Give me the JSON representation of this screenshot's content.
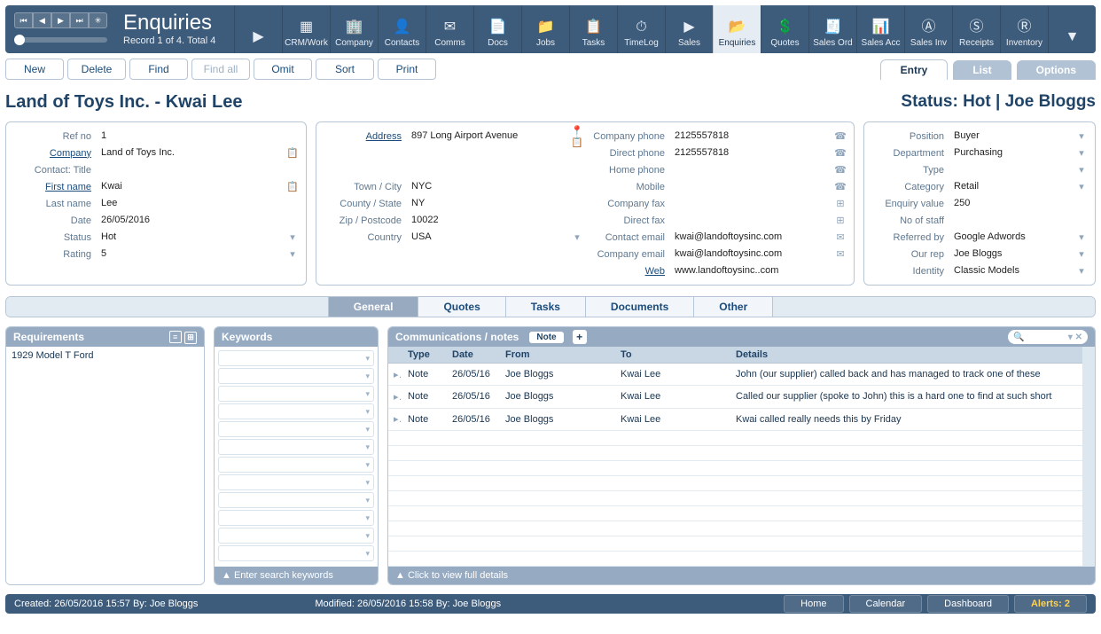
{
  "header": {
    "title": "Enquiries",
    "record_status": "Record 1 of 4. Total 4",
    "nav_buttons": [
      "first",
      "prev",
      "next",
      "last",
      "new"
    ]
  },
  "toolbar": [
    {
      "id": "back",
      "label": "",
      "icon": "▶"
    },
    {
      "id": "crmwork",
      "label": "CRM/Work",
      "icon": "▦"
    },
    {
      "id": "company",
      "label": "Company",
      "icon": "🏢"
    },
    {
      "id": "contacts",
      "label": "Contacts",
      "icon": "👤"
    },
    {
      "id": "comms",
      "label": "Comms",
      "icon": "✉"
    },
    {
      "id": "docs",
      "label": "Docs",
      "icon": "📄"
    },
    {
      "id": "jobs",
      "label": "Jobs",
      "icon": "📁"
    },
    {
      "id": "tasks",
      "label": "Tasks",
      "icon": "📋"
    },
    {
      "id": "timelog",
      "label": "TimeLog",
      "icon": "⏱"
    },
    {
      "id": "sales-nav",
      "label": "Sales",
      "icon": "▶"
    },
    {
      "id": "enquiries",
      "label": "Enquiries",
      "icon": "📂",
      "selected": true
    },
    {
      "id": "quotes",
      "label": "Quotes",
      "icon": "💲"
    },
    {
      "id": "salesord",
      "label": "Sales Ord",
      "icon": "🧾"
    },
    {
      "id": "salesacc",
      "label": "Sales Acc",
      "icon": "📊"
    },
    {
      "id": "salesinv",
      "label": "Sales Inv",
      "icon": "Ⓐ"
    },
    {
      "id": "receipts",
      "label": "Receipts",
      "icon": "Ⓢ"
    },
    {
      "id": "inventory",
      "label": "Inventory",
      "icon": "Ⓡ"
    },
    {
      "id": "more",
      "label": "",
      "icon": "▼"
    }
  ],
  "actions": {
    "new": "New",
    "delete": "Delete",
    "find": "Find",
    "find_all": "Find all",
    "omit": "Omit",
    "sort": "Sort",
    "print": "Print"
  },
  "top_tabs": [
    {
      "id": "entry",
      "label": "Entry",
      "active": true
    },
    {
      "id": "list",
      "label": "List"
    },
    {
      "id": "options",
      "label": "Options"
    }
  ],
  "heading": {
    "title": "Land of Toys Inc. - Kwai Lee",
    "status": "Status: Hot | Joe Bloggs"
  },
  "left_panel": {
    "ref_no": {
      "label": "Ref no",
      "value": "1"
    },
    "company": {
      "label": "Company",
      "value": "Land of Toys Inc.",
      "link": true
    },
    "contact_title": {
      "label": "Contact: Title",
      "value": ""
    },
    "first_name": {
      "label": "First name",
      "value": "Kwai",
      "link": true
    },
    "last_name": {
      "label": "Last name",
      "value": "Lee"
    },
    "date": {
      "label": "Date",
      "value": "26/05/2016"
    },
    "status": {
      "label": "Status",
      "value": "Hot"
    },
    "rating": {
      "label": "Rating",
      "value": "5"
    }
  },
  "mid_panel": {
    "address": {
      "label": "Address",
      "value": "897 Long Airport Avenue",
      "link": true
    },
    "town": {
      "label": "Town / City",
      "value": "NYC"
    },
    "county": {
      "label": "County / State",
      "value": "NY"
    },
    "zip": {
      "label": "Zip / Postcode",
      "value": "10022"
    },
    "country": {
      "label": "Country",
      "value": "USA"
    }
  },
  "phone_panel": {
    "company_phone": {
      "label": "Company phone",
      "value": "2125557818"
    },
    "direct_phone": {
      "label": "Direct phone",
      "value": "2125557818"
    },
    "home_phone": {
      "label": "Home phone",
      "value": ""
    },
    "mobile": {
      "label": "Mobile",
      "value": ""
    },
    "company_fax": {
      "label": "Company fax",
      "value": ""
    },
    "direct_fax": {
      "label": "Direct fax",
      "value": ""
    },
    "contact_email": {
      "label": "Contact email",
      "value": "kwai@landoftoysinc.com"
    },
    "company_email": {
      "label": "Company email",
      "value": "kwai@landoftoysinc.com"
    },
    "web": {
      "label": "Web",
      "value": "www.landoftoysinc..com",
      "link": true
    }
  },
  "right_panel": {
    "position": {
      "label": "Position",
      "value": "Buyer"
    },
    "department": {
      "label": "Department",
      "value": "Purchasing"
    },
    "type": {
      "label": "Type",
      "value": ""
    },
    "category": {
      "label": "Category",
      "value": "Retail"
    },
    "enquiry_value": {
      "label": "Enquiry value",
      "value": "250"
    },
    "no_of_staff": {
      "label": "No of staff",
      "value": ""
    },
    "referred_by": {
      "label": "Referred by",
      "value": "Google Adwords"
    },
    "our_rep": {
      "label": "Our rep",
      "value": "Joe Bloggs"
    },
    "identity": {
      "label": "Identity",
      "value": "Classic Models"
    }
  },
  "mid_tabs": [
    {
      "id": "general",
      "label": "General",
      "active": true
    },
    {
      "id": "quotes",
      "label": "Quotes"
    },
    {
      "id": "tasks",
      "label": "Tasks"
    },
    {
      "id": "documents",
      "label": "Documents"
    },
    {
      "id": "other",
      "label": "Other"
    }
  ],
  "requirements": {
    "title": "Requirements",
    "text": "1929 Model T Ford"
  },
  "keywords": {
    "title": "Keywords",
    "footer": "▲  Enter search keywords"
  },
  "comm": {
    "title": "Communications / notes",
    "note_btn": "Note",
    "columns": {
      "type": "Type",
      "date": "Date",
      "from": "From",
      "to": "To",
      "details": "Details"
    },
    "rows": [
      {
        "type": "Note",
        "date": "26/05/16",
        "from": "Joe Bloggs",
        "to": "Kwai Lee",
        "details": "John (our supplier) called back and has managed to track one of these"
      },
      {
        "type": "Note",
        "date": "26/05/16",
        "from": "Joe Bloggs",
        "to": "Kwai Lee",
        "details": "Called our supplier (spoke to John) this is a hard one to find at such short"
      },
      {
        "type": "Note",
        "date": "26/05/16",
        "from": "Joe Bloggs",
        "to": "Kwai Lee",
        "details": "Kwai called really needs this by Friday"
      }
    ],
    "footer": "▲  Click to view full details"
  },
  "footer": {
    "created": "Created: 26/05/2016  15:57   By: Joe Bloggs",
    "modified": "Modified: 26/05/2016  15:58   By: Joe Bloggs",
    "home": "Home",
    "calendar": "Calendar",
    "dashboard": "Dashboard",
    "alerts": "Alerts: 2"
  }
}
